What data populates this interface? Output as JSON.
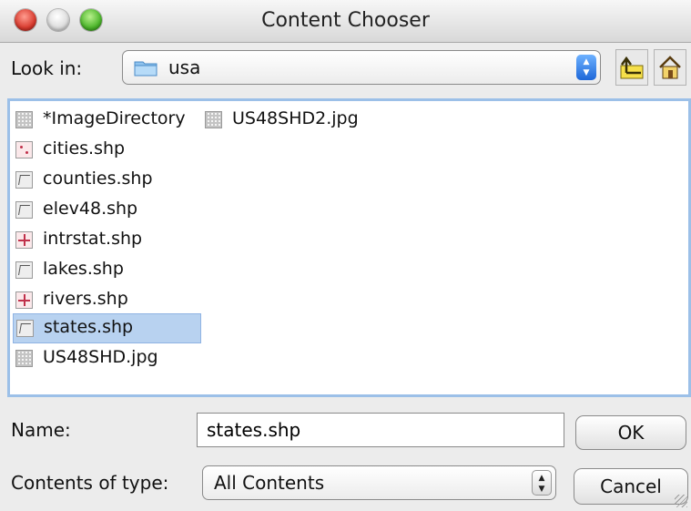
{
  "window": {
    "title": "Content Chooser"
  },
  "look_in": {
    "label": "Look in:",
    "value": "usa"
  },
  "toolbar": {
    "up_icon": "folder-up-icon",
    "home_icon": "home-icon"
  },
  "files": [
    {
      "name": "*ImageDirectory",
      "icon": "image",
      "selected": false
    },
    {
      "name": "US48SHD2.jpg",
      "icon": "image",
      "selected": false
    },
    {
      "name": "cities.shp",
      "icon": "points",
      "selected": false
    },
    {
      "name": "counties.shp",
      "icon": "polygon",
      "selected": false
    },
    {
      "name": "elev48.shp",
      "icon": "polygon",
      "selected": false
    },
    {
      "name": "intrstat.shp",
      "icon": "line",
      "selected": false
    },
    {
      "name": "lakes.shp",
      "icon": "polygon",
      "selected": false
    },
    {
      "name": "rivers.shp",
      "icon": "line",
      "selected": false
    },
    {
      "name": "states.shp",
      "icon": "polygon",
      "selected": true
    },
    {
      "name": "US48SHD.jpg",
      "icon": "image",
      "selected": false
    }
  ],
  "name_field": {
    "label": "Name:",
    "value": "states.shp"
  },
  "content_type": {
    "label": "Contents of type:",
    "value": "All Contents"
  },
  "buttons": {
    "ok": "OK",
    "cancel": "Cancel"
  },
  "colors": {
    "selection": "#b8d2f0",
    "list_border": "#9cc0e8",
    "accent": "#1e67d8"
  }
}
